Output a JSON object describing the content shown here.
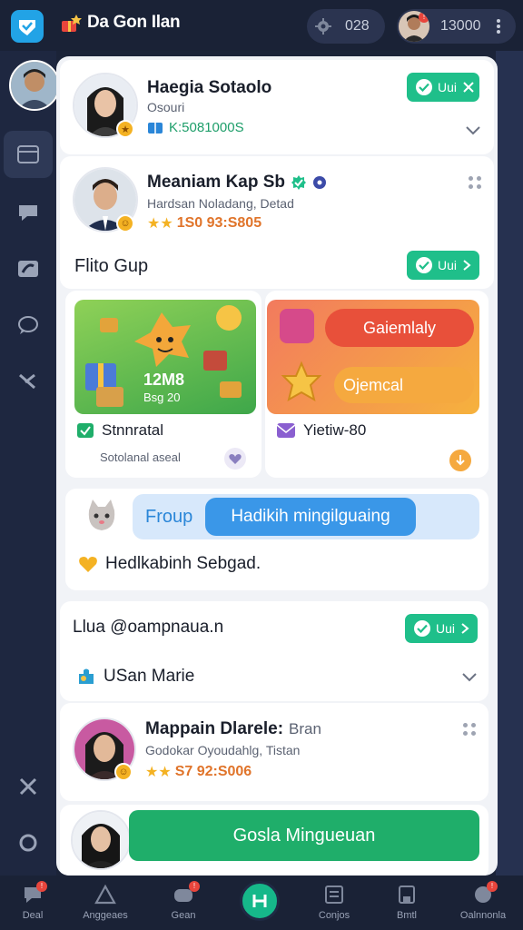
{
  "header": {
    "title": "Da Gon Ilan",
    "left_pill_value": "028",
    "right_pill_value": "13000",
    "colors": {
      "bar": "#1a2236",
      "accent": "#22a3e6"
    }
  },
  "profile_card": {
    "name": "Haegia Sotaolo",
    "subtitle": "Osouri",
    "id_text": "K:5081000S",
    "follow_label": "Uui"
  },
  "member_card": {
    "name": "Meaniam Kap Sb",
    "subtitle": "Hardsan Noladang, Detad",
    "score_text": "1S0 93:S805"
  },
  "group_section": {
    "title": "Flito Gup",
    "button_label": "Uui"
  },
  "promo": {
    "left_tile_count": "12M8",
    "left_tile_sub": "Bsg 20",
    "left_caption_title": "Stnnratal",
    "left_caption_sub": "Sotolanal aseal",
    "right_primary_btn": "Gaiemlaly",
    "right_secondary_btn": "Ojemcal",
    "right_caption": "Yietiw-80"
  },
  "group_banner": {
    "label": "Froup",
    "highlight": "Hadikih mingilguaing",
    "message": "Hedlkabinh Sebgad."
  },
  "contact_card": {
    "title": "Llua @oampnaua.n",
    "button_label": "Uui",
    "member_name": "USan Marie"
  },
  "member_card_2": {
    "name": "Mappain Dlarele:",
    "name_suffix": "Bran",
    "subtitle": "Godokar Oyoudahlg, Tistan",
    "score_text": "S7 92:S006"
  },
  "cta": {
    "label": "Gosla Mingueuan"
  },
  "bottom_nav": {
    "items": [
      "Deal",
      "Anggeaes",
      "Gean",
      "Conjos",
      "Bmtl",
      "Oalnnonla"
    ]
  }
}
